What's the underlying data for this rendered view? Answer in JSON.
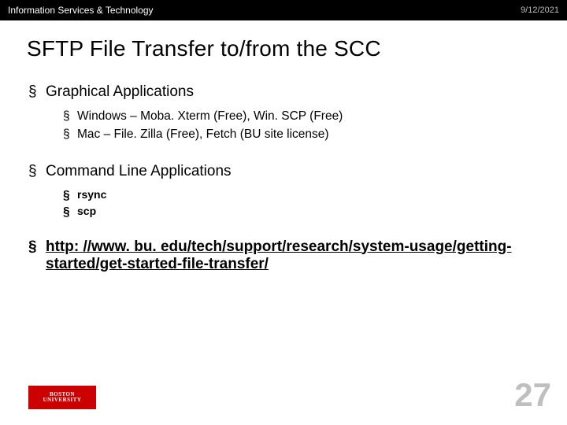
{
  "header": {
    "org": "Information Services & Technology",
    "date": "9/12/2021"
  },
  "title": "SFTP File Transfer to/from the SCC",
  "sections": [
    {
      "heading": "Graphical Applications",
      "items": [
        "Windows – Moba. Xterm (Free), Win. SCP (Free)",
        "Mac – File. Zilla (Free), Fetch (BU site license)"
      ],
      "bold_items": false
    },
    {
      "heading": "Command Line Applications",
      "items": [
        "rsync",
        "scp"
      ],
      "bold_items": true
    }
  ],
  "link": {
    "text": "http: //www. bu. edu/tech/support/research/system-usage/getting-started/get-started-file-transfer/"
  },
  "footer": {
    "logo_top": "BOSTON",
    "logo_bottom": "UNIVERSITY",
    "page_number": "27"
  }
}
